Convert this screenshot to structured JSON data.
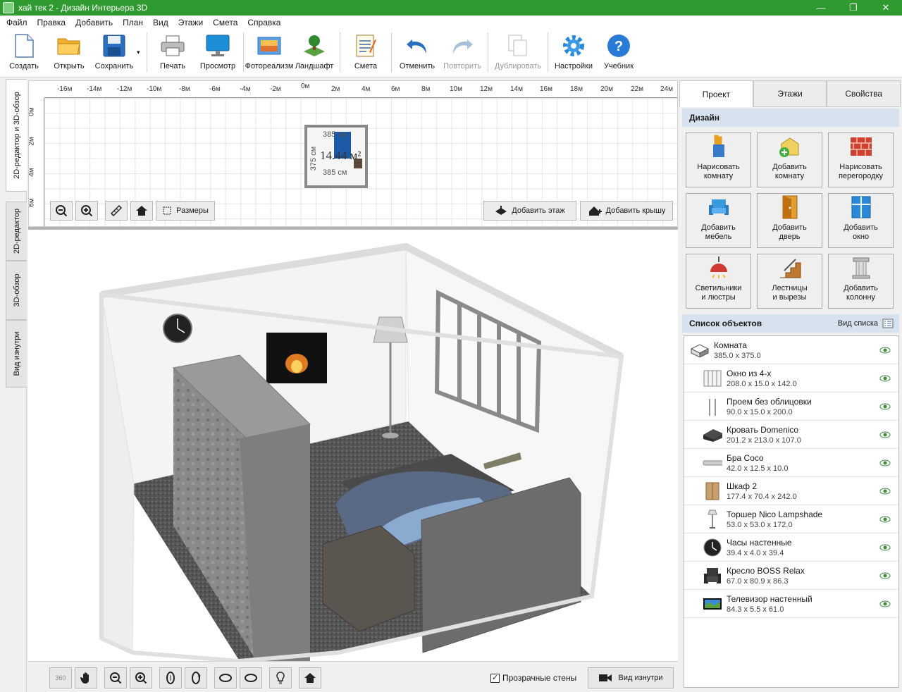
{
  "titlebar": {
    "title": "хай тек 2 - Дизайн Интерьера 3D",
    "minimize": "—",
    "maximize": "❐",
    "close": "✕"
  },
  "menu": [
    "Файл",
    "Правка",
    "Добавить",
    "План",
    "Вид",
    "Этажи",
    "Смета",
    "Справка"
  ],
  "toolbar": {
    "create": "Создать",
    "open": "Открыть",
    "save": "Сохранить",
    "dropdown": "▾",
    "print": "Печать",
    "preview": "Просмотр",
    "photoreal": "Фотореализм",
    "landscape": "Ландшафт",
    "estimate": "Смета",
    "undo": "Отменить",
    "redo": "Повторить",
    "duplicate": "Дублировать",
    "settings": "Настройки",
    "tutorial": "Учебник"
  },
  "vtabs": [
    "2D-редактор и 3D-обзор",
    "2D-редактор",
    "3D-обзор",
    "Вид изнутри"
  ],
  "plan": {
    "ruler_x": [
      "-16м",
      "-14м",
      "-12м",
      "-10м",
      "-8м",
      "-6м",
      "-4м",
      "-2м",
      "0м",
      "2м",
      "4м",
      "6м",
      "8м",
      "10м",
      "12м",
      "14м",
      "16м",
      "18м",
      "20м",
      "22м",
      "24м"
    ],
    "ruler_y": [
      "0м",
      "2м",
      "4м",
      "6м"
    ],
    "room_area": "14.44 м²",
    "dim_top": "385 см",
    "dim_bottom": "385 см",
    "dim_left": "375 см",
    "dimensions_btn": "Размеры",
    "add_floor_btn": "Добавить этаж",
    "add_roof_btn": "Добавить крышу"
  },
  "bottom": {
    "transparent_walls": "Прозрачные стены",
    "checked": "✓",
    "inside_view": "Вид изнутри",
    "rotate360": "360"
  },
  "rtabs": [
    "Проект",
    "Этажи",
    "Свойства"
  ],
  "design": {
    "title": "Дизайн",
    "buttons": [
      {
        "line1": "Нарисовать",
        "line2": "комнату"
      },
      {
        "line1": "Добавить",
        "line2": "комнату"
      },
      {
        "line1": "Нарисовать",
        "line2": "перегородку"
      },
      {
        "line1": "Добавить",
        "line2": "мебель"
      },
      {
        "line1": "Добавить",
        "line2": "дверь"
      },
      {
        "line1": "Добавить",
        "line2": "окно"
      },
      {
        "line1": "Светильники",
        "line2": "и люстры"
      },
      {
        "line1": "Лестницы",
        "line2": "и вырезы"
      },
      {
        "line1": "Добавить",
        "line2": "колонну"
      }
    ]
  },
  "objects": {
    "title": "Список объектов",
    "view_label": "Вид списка",
    "items": [
      {
        "name": "Комната",
        "dims": "385.0 x 375.0"
      },
      {
        "name": "Окно из 4-х",
        "dims": "208.0 x 15.0 x 142.0"
      },
      {
        "name": "Проем без облицовки",
        "dims": "90.0 x 15.0 x 200.0"
      },
      {
        "name": "Кровать Domenico",
        "dims": "201.2 x 213.0 x 107.0"
      },
      {
        "name": "Бра Coco",
        "dims": "42.0 x 12.5 x 10.0"
      },
      {
        "name": "Шкаф 2",
        "dims": "177.4 x 70.4 x 242.0"
      },
      {
        "name": "Торшер Nico Lampshade",
        "dims": "53.0 x 53.0 x 172.0"
      },
      {
        "name": "Часы настенные",
        "dims": "39.4 x 4.0 x 39.4"
      },
      {
        "name": "Кресло BOSS Relax",
        "dims": "67.0 x 80.9 x 86.3"
      },
      {
        "name": "Телевизор настенный",
        "dims": "84.3 x 5.5 x 61.0"
      }
    ]
  },
  "colors": {
    "titlebar": "#2f9a2f",
    "section": "#d7e2ef",
    "accent_blue": "#1c5aa8",
    "eye": "#3a8a3a"
  }
}
